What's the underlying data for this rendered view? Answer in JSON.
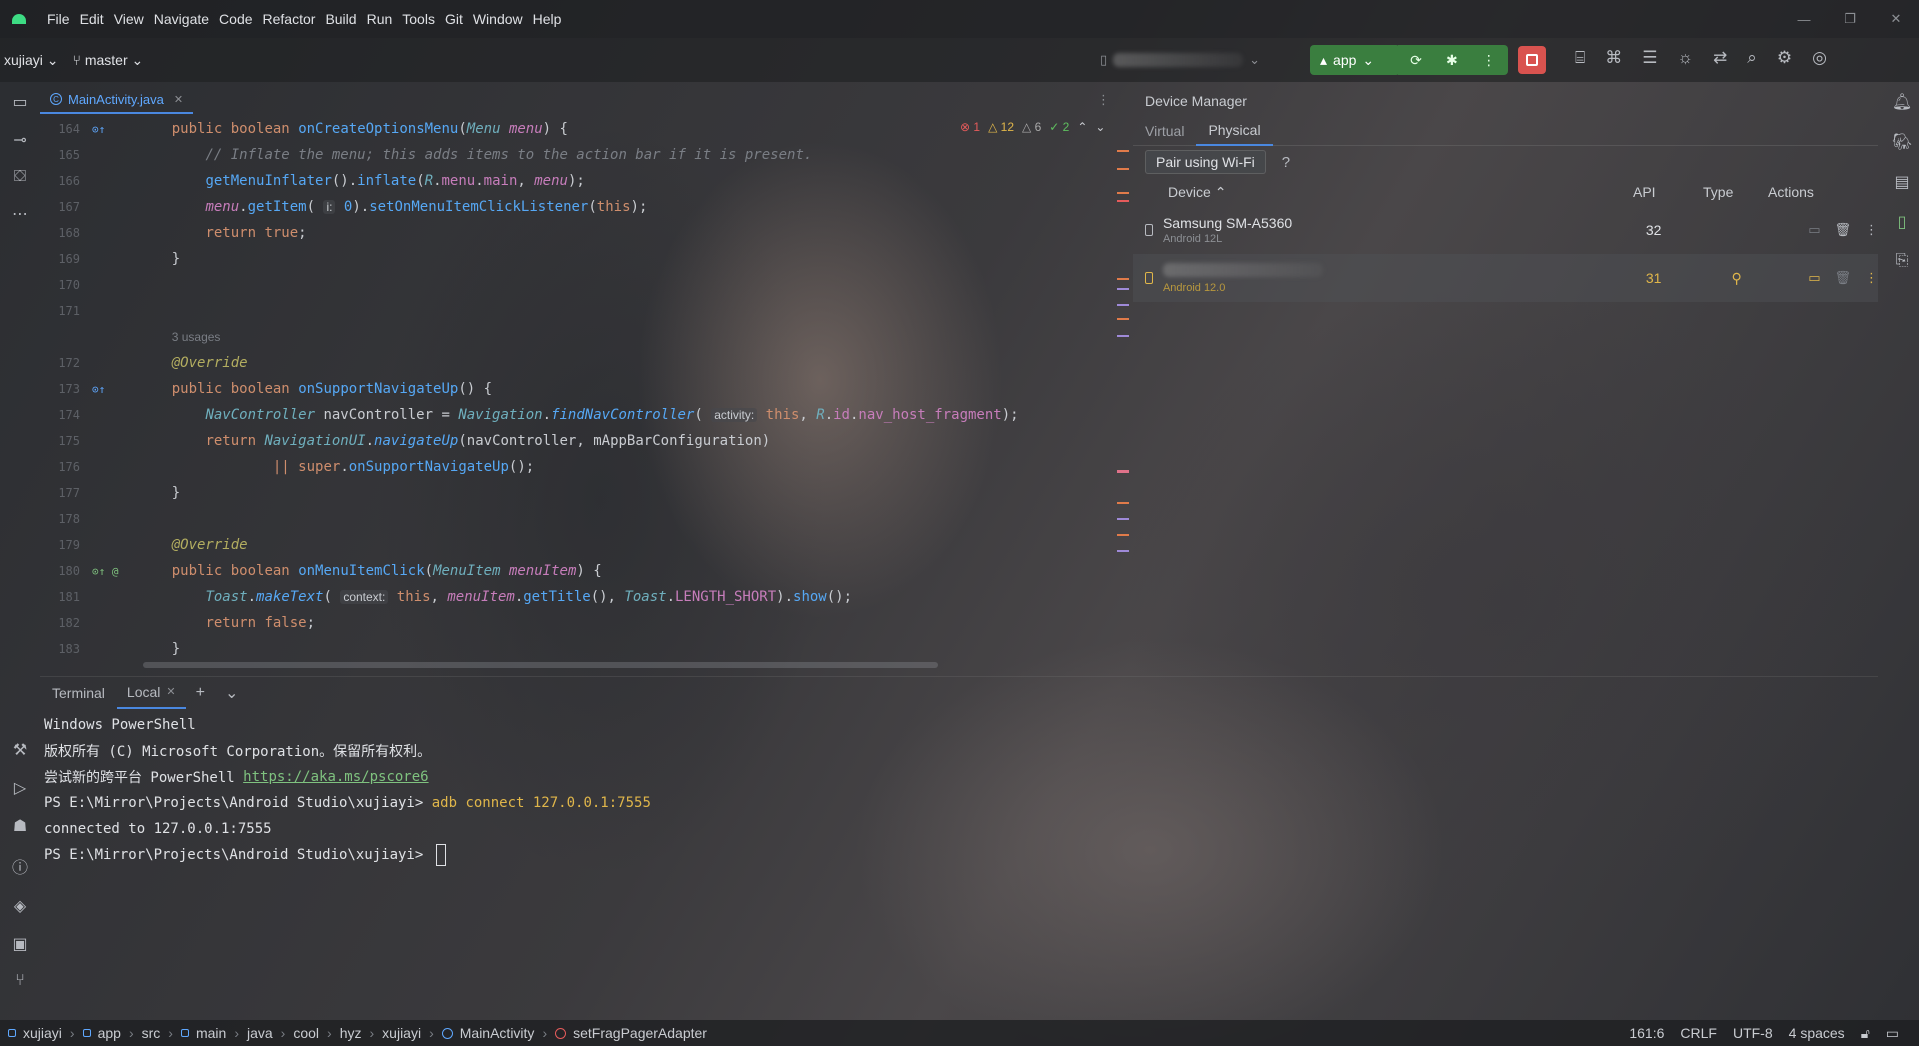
{
  "menubar": {
    "items": [
      "File",
      "Edit",
      "View",
      "Navigate",
      "Code",
      "Refactor",
      "Build",
      "Run",
      "Tools",
      "Git",
      "Window",
      "Help"
    ]
  },
  "toolbar": {
    "project": "xujiayi",
    "branch": "master",
    "run_config": "app"
  },
  "editor": {
    "tab_label": "MainActivity.java",
    "inspections": {
      "errors": "1",
      "warnings": "12",
      "weak": "6",
      "ok": "2"
    },
    "lines": [
      {
        "n": "164"
      },
      {
        "n": "165"
      },
      {
        "n": "166"
      },
      {
        "n": "167"
      },
      {
        "n": "168"
      },
      {
        "n": "169"
      },
      {
        "n": "170"
      },
      {
        "n": "171"
      },
      {
        "n": "172"
      },
      {
        "n": "173"
      },
      {
        "n": "174"
      },
      {
        "n": "175"
      },
      {
        "n": "176"
      },
      {
        "n": "177"
      },
      {
        "n": "178"
      },
      {
        "n": "179"
      },
      {
        "n": "180"
      },
      {
        "n": "181"
      },
      {
        "n": "182"
      },
      {
        "n": "183"
      }
    ],
    "tokens": {
      "public": "public",
      "boolean": "boolean",
      "onCreateOptionsMenu": "onCreateOptionsMenu",
      "Menu": "Menu",
      "menu": "menu",
      "comment": "// Inflate the menu; this adds items to the action bar if it is present.",
      "getMenuInflater": "getMenuInflater",
      "inflate": "inflate",
      "R": "R",
      "menu_field": "menu",
      "main": "main",
      "getItem": "getItem",
      "hint_i": "i:",
      "zero": "0",
      "setOnMenuItemClickListener": "setOnMenuItemClickListener",
      "this": "this",
      "return": "return",
      "true": "true",
      "false": "false",
      "usages": "3 usages",
      "override": "@Override",
      "onSupportNavigateUp": "onSupportNavigateUp",
      "NavController": "NavController",
      "navController": "navController",
      "Navigation": "Navigation",
      "findNavController": "findNavController",
      "hint_activity": "activity:",
      "id": "id",
      "nav_host_fragment": "nav_host_fragment",
      "NavigationUI": "NavigationUI",
      "navigateUp": "navigateUp",
      "mAppBarConfiguration": "mAppBarConfiguration",
      "or_super": "|| ",
      "super": "super",
      "onMenuItemClick": "onMenuItemClick",
      "MenuItem": "MenuItem",
      "menuItem": "menuItem",
      "Toast": "Toast",
      "makeText": "makeText",
      "hint_context": "context:",
      "getTitle": "getTitle",
      "LENGTH_SHORT": "LENGTH_SHORT",
      "show": "show"
    }
  },
  "device_manager": {
    "title": "Device Manager",
    "tabs": [
      "Virtual",
      "Physical"
    ],
    "pair_button": "Pair using Wi-Fi",
    "help": "?",
    "columns": {
      "device": "Device",
      "api": "API",
      "type": "Type",
      "actions": "Actions"
    },
    "devices": [
      {
        "name": "Samsung SM-A5360",
        "os": "Android 12L",
        "api": "32"
      },
      {
        "name": "",
        "os": "Android 12.0",
        "api": "31"
      }
    ]
  },
  "terminal": {
    "label": "Terminal",
    "tab": "Local",
    "lines": {
      "l1": "Windows PowerShell",
      "l2": "版权所有 (C) Microsoft Corporation。保留所有权利。",
      "l3_prefix": "尝试新的跨平台 PowerShell ",
      "l3_link": "https://aka.ms/pscore6",
      "prompt": "PS E:\\Mirror\\Projects\\Android Studio\\xujiayi> ",
      "cmd": "adb connect 127.0.0.1:7555",
      "l5": "connected to 127.0.0.1:7555"
    }
  },
  "statusbar": {
    "breadcrumb": [
      "xujiayi",
      "app",
      "src",
      "main",
      "java",
      "cool",
      "hyz",
      "xujiayi",
      "MainActivity",
      "setFragPagerAdapter"
    ],
    "position": "161:6",
    "line_sep": "CRLF",
    "encoding": "UTF-8",
    "indent": "4 spaces"
  }
}
